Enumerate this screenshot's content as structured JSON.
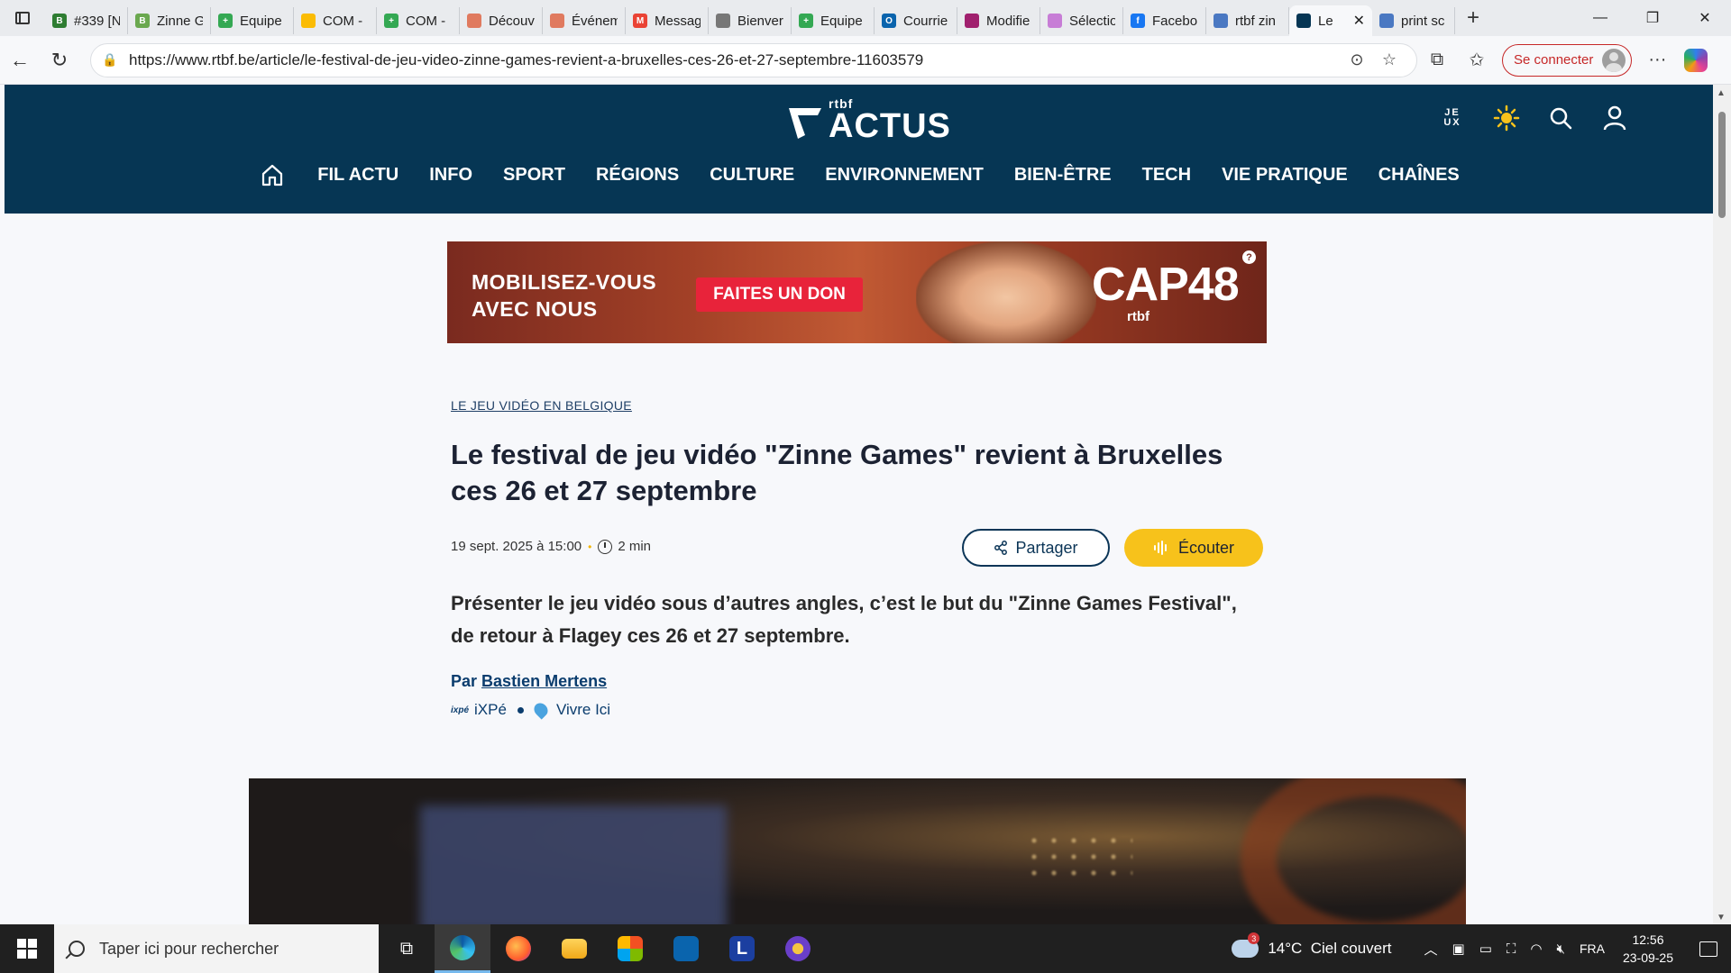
{
  "browser": {
    "tabs": [
      {
        "title": "#339 [N",
        "favicon": "B",
        "color": "#2e7d32"
      },
      {
        "title": "Zinne G",
        "favicon": "B",
        "color": "#6aa84f"
      },
      {
        "title": "Equipe",
        "favicon": "+",
        "color": "#34a853"
      },
      {
        "title": "COM -",
        "favicon": "drive-icon",
        "color": "#fbbc04"
      },
      {
        "title": "COM -",
        "favicon": "+",
        "color": "#34a853"
      },
      {
        "title": "Découv",
        "favicon": "hand-icon",
        "color": "#e07a5f"
      },
      {
        "title": "Événem",
        "favicon": "hand-icon",
        "color": "#e07a5f"
      },
      {
        "title": "Messag",
        "favicon": "M",
        "color": "#ea4335"
      },
      {
        "title": "Bienver",
        "favicon": "globe-icon",
        "color": "#777777"
      },
      {
        "title": "Equipe",
        "favicon": "+",
        "color": "#34a853"
      },
      {
        "title": "Courrie",
        "favicon": "O",
        "color": "#0a64ad"
      },
      {
        "title": "Modifie",
        "favicon": "",
        "color": "#a0206e"
      },
      {
        "title": "Sélectio",
        "favicon": "",
        "color": "#c77dd6"
      },
      {
        "title": "Facebo",
        "favicon": "f",
        "color": "#1877f2"
      },
      {
        "title": "rtbf zin",
        "favicon": "search-icon",
        "color": "#4a78c2"
      },
      {
        "title": "Le",
        "favicon": "rtbf-icon",
        "color": "#063654",
        "active": true
      },
      {
        "title": "print sc",
        "favicon": "search-icon",
        "color": "#4a78c2"
      }
    ],
    "url": "https://www.rtbf.be/article/le-festival-de-jeu-video-zinne-games-revient-a-bruxelles-ces-26-et-27-septembre-11603579",
    "signin_label": "Se connecter"
  },
  "site": {
    "logo_small": "rtbf",
    "logo_main": "ACTUS",
    "jeux_label": "JE\nUX",
    "nav": [
      "FIL ACTU",
      "INFO",
      "SPORT",
      "RÉGIONS",
      "CULTURE",
      "ENVIRONNEMENT",
      "BIEN-ÊTRE",
      "TECH",
      "VIE PRATIQUE",
      "CHAÎNES"
    ]
  },
  "ad": {
    "line1": "MOBILISEZ-VOUS",
    "line2": "AVEC NOUS",
    "cta": "FAITES UN DON",
    "brand": "CAP48",
    "brand_sub": "rtbf",
    "help": "?"
  },
  "article": {
    "kicker": "LE JEU VIDÉO EN BELGIQUE",
    "title": "Le festival de jeu vidéo \"Zinne Games\" revient à Bruxelles ces 26 et 27 septembre",
    "date": "19 sept. 2025 à 15:00",
    "read_time": "2 min",
    "share_label": "Partager",
    "listen_label": "Écouter",
    "chapo": "Présenter le jeu vidéo sous d’autres angles, c’est le but du \"Zinne Games Festival\", de retour à Flagey ces 26 et 27 septembre.",
    "by_prefix": "Par",
    "author": "Bastien Mertens",
    "tags": [
      "iXPé",
      "Vivre Ici"
    ],
    "tag_logo": "ixpé"
  },
  "taskbar": {
    "search_placeholder": "Taper ici pour rechercher",
    "weather": "14°C  Ciel couvert",
    "weather_badge": "3",
    "lang": "FRA",
    "time": "12:56",
    "date": "23-09-25"
  }
}
